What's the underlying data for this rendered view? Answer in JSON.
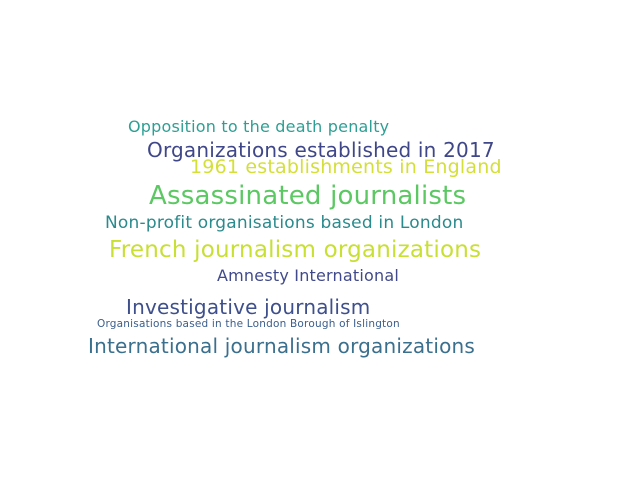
{
  "words": [
    {
      "text": "Opposition to the death penalty",
      "color": "#2e9f94"
    },
    {
      "text": "Organizations established in 2017",
      "color": "#3f4788"
    },
    {
      "text": "1961 establishments in England",
      "color": "#d4df3a"
    },
    {
      "text": "Assassinated journalists",
      "color": "#5cc863"
    },
    {
      "text": "Non-profit organisations based in London",
      "color": "#2a8a8c"
    },
    {
      "text": "French journalism organizations",
      "color": "#c8df34"
    },
    {
      "text": "Amnesty International",
      "color": "#404a8b"
    },
    {
      "text": "Investigative journalism",
      "color": "#3e4f8b"
    },
    {
      "text": "Organisations based in the London Borough of Islington",
      "color": "#3b5e8c"
    },
    {
      "text": "International journalism organizations",
      "color": "#3b6f8e"
    }
  ]
}
